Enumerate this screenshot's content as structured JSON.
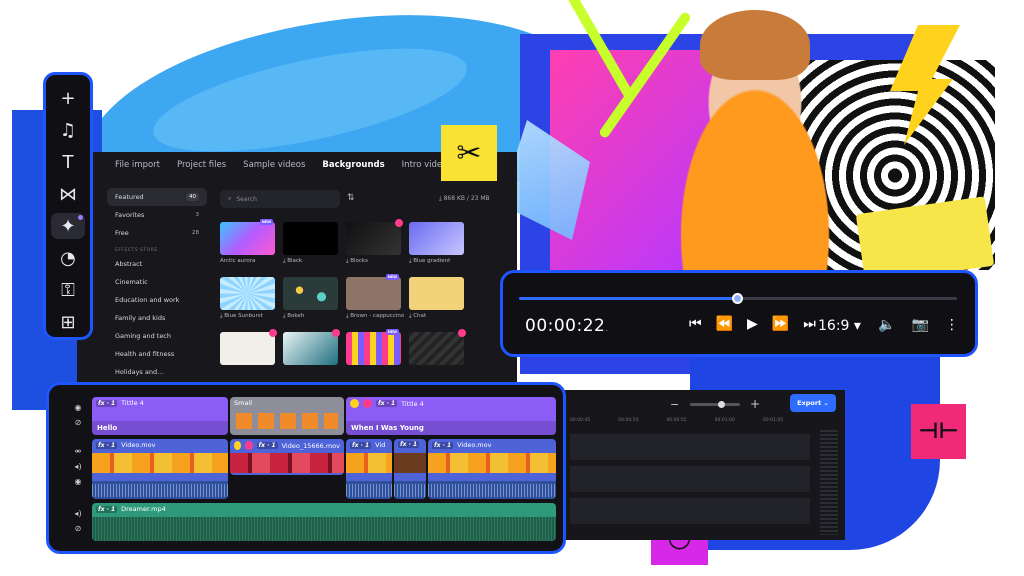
{
  "sidebar": {
    "items": [
      {
        "icon": "plus-icon",
        "glyph": "+"
      },
      {
        "icon": "music-icon",
        "glyph": "♫"
      },
      {
        "icon": "text-icon",
        "glyph": "T"
      },
      {
        "icon": "transitions-icon",
        "glyph": "⋈"
      },
      {
        "icon": "effects-icon",
        "glyph": "✦",
        "active": true
      },
      {
        "icon": "sticker-icon",
        "glyph": "◔"
      },
      {
        "icon": "plugins-icon",
        "glyph": "⚿"
      },
      {
        "icon": "more-icon",
        "glyph": "⊞"
      }
    ]
  },
  "browser": {
    "tabs": [
      "File import",
      "Project files",
      "Sample videos",
      "Backgrounds",
      "Intro videos"
    ],
    "active_tab": "Backgrounds",
    "categories": [
      {
        "label": "Featured",
        "count": "40",
        "active": true
      },
      {
        "label": "Favorites",
        "count": "3"
      },
      {
        "label": "Free",
        "count": "28"
      }
    ],
    "section_label": "EFFECTS STORE",
    "store_categories": [
      "Abstract",
      "Cinematic",
      "Education and work",
      "Family and kids",
      "Gaming and tech",
      "Health and fitness",
      "Holidays and..."
    ],
    "search_placeholder": "Search",
    "storage": "868 KB / 23 MB",
    "thumbnails": [
      {
        "label": "Arctic aurora",
        "badge": "NEW",
        "color": "linear-gradient(135deg,#3cc3ff,#b35cff,#ff5ad0)"
      },
      {
        "label": "Black",
        "download": true,
        "color": "#000000"
      },
      {
        "label": "Blocks",
        "download": true,
        "crown": true,
        "color": "linear-gradient(135deg,#111,#333)"
      },
      {
        "label": "Blue gradient",
        "download": true,
        "color": "linear-gradient(135deg,#6a6cf0,#c9c6ff)"
      },
      {
        "label": "Blue Sunburst",
        "download": true,
        "color": "repeating-conic-gradient(#8fd3ff 0 10deg,#c6ecff 10deg 20deg)"
      },
      {
        "label": "Bokeh",
        "download": true,
        "color": "radial-gradient(circle at 30% 40%,#f7c948 0 8%,transparent 9%),radial-gradient(circle at 70% 60%,#5ad0c4 0 10%,transparent 11%),#2a3b3a"
      },
      {
        "label": "Brown - cappuccino",
        "download": true,
        "badge": "NEW",
        "color": "#8e7466"
      },
      {
        "label": "Chat",
        "download": true,
        "color": "#f2d37a"
      },
      {
        "label": "",
        "crown": true,
        "color": "#f2eee8"
      },
      {
        "label": "",
        "crown": true,
        "color": "linear-gradient(135deg,#e9f4f6,#1f6f7f)"
      },
      {
        "label": "",
        "badge": "NEW",
        "color": "repeating-linear-gradient(90deg,#ff3b8d 0 6px,#ffd21e 6px 12px,#7a5cff 12px 18px)"
      },
      {
        "label": "",
        "crown": true,
        "color": "repeating-linear-gradient(135deg,#222 0 4px,#333 4px 8px)"
      }
    ]
  },
  "player": {
    "timecode": "00:00:22",
    "timecode_frac": ".",
    "progress": 0.5,
    "ratio": "16:9 ▾",
    "controls": [
      "⏮",
      "⏪",
      "▶",
      "⏩",
      "⏭"
    ],
    "right_controls": [
      "🔈",
      "📷",
      "⋮"
    ]
  },
  "editor": {
    "export_label": "Export ⌄",
    "ruler": [
      "00:00:45",
      "00:00:50",
      "00:00:55",
      "00:01:00",
      "00:01:05"
    ]
  },
  "timeline": {
    "title_clips": [
      {
        "label": "Tittle 4",
        "text": "Hello",
        "fx": "fx · 1"
      },
      {
        "label": "Smail",
        "text": ""
      },
      {
        "label": "Tittle 4",
        "text": "When I Was Young",
        "fx": "fx · 1"
      }
    ],
    "video_clips": [
      {
        "label": "Video.mov",
        "fx": "fx · 1"
      },
      {
        "label": "Video_15666.mov",
        "fx": "fx · 1"
      },
      {
        "label": "Vid",
        "fx": "fx · 1"
      },
      {
        "label": "",
        "fx": "fx · 1"
      },
      {
        "label": "Video.mov",
        "fx": "fx · 1"
      }
    ],
    "audio_clip": {
      "label": "Dreamer.mp4",
      "fx": "fx · 1"
    }
  },
  "colors": {
    "accent": "#1e55ff",
    "title_track": "#8b5cf6",
    "video_track": "#4e63d8",
    "audio_track": "#2f9a7a"
  }
}
